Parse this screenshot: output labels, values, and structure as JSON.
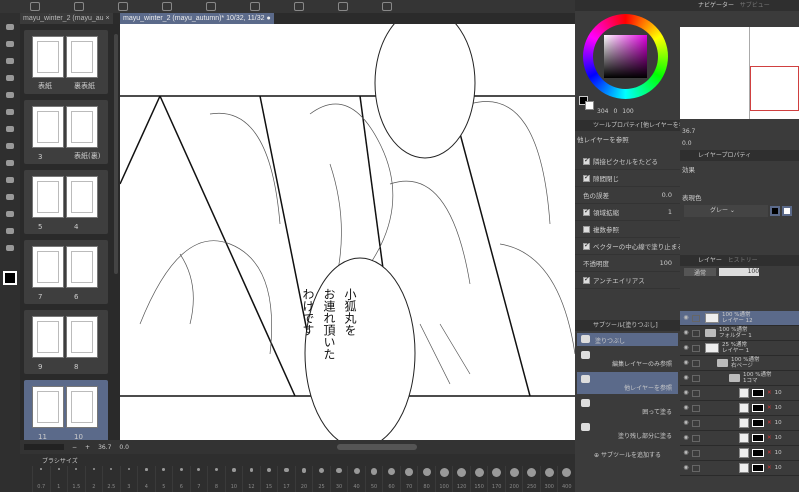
{
  "tabs": [
    {
      "label": "mayu_winter_2 (mayu_au"
    },
    {
      "label": "mayu_winter_2 (mayu_autumn)* 10/32, 11/32"
    }
  ],
  "pages": [
    {
      "left": "表紙",
      "right": "裏表紙"
    },
    {
      "left": "3",
      "right": "表紙(裏)"
    },
    {
      "left": "5",
      "right": "4"
    },
    {
      "left": "7",
      "right": "6"
    },
    {
      "left": "9",
      "right": "8"
    },
    {
      "left": "11",
      "right": "10",
      "selected": true
    }
  ],
  "canvas": {
    "bubble_text": [
      "小狐丸を",
      "お連れ頂いた",
      "わけです"
    ]
  },
  "status": {
    "zoom": "36.7",
    "angle": "0.0"
  },
  "brush_panel": {
    "title": "ブラシサイズ",
    "sizes": [
      "0.7",
      "1",
      "1.5",
      "2",
      "2.5",
      "3",
      "4",
      "5",
      "6",
      "7",
      "8",
      "10",
      "12",
      "15",
      "17",
      "20",
      "25",
      "30",
      "40",
      "50",
      "60",
      "70",
      "80",
      "100",
      "120",
      "150",
      "170",
      "200",
      "250",
      "300",
      "400"
    ]
  },
  "color": {
    "main": "#000000",
    "sub": "#ffffff",
    "h": "304",
    "s": "0",
    "v": "100",
    "hue_color": "#e000e0"
  },
  "navigator": {
    "tab": "ナビゲーター",
    "tab2": "サブビュー",
    "zoom": "36.7",
    "angle": "0.0"
  },
  "tool_property": {
    "title": "ツールプロパティ[他レイヤーを参",
    "subtool": "他レイヤーを参照",
    "rows": [
      {
        "label": "隣接ピクセルをたどる",
        "checked": true
      },
      {
        "label": "隙間閉じ",
        "checked": true
      },
      {
        "label": "色の誤差",
        "value": "0.0"
      },
      {
        "label": "領域拡縮",
        "checked": true,
        "value": "1"
      },
      {
        "label": "複数参照",
        "checked": false
      },
      {
        "label": "ベクターの中心線で塗り止まる",
        "checked": true
      },
      {
        "label": "不透明度",
        "value": "100"
      },
      {
        "label": "アンチエイリアス",
        "checked": true
      }
    ]
  },
  "subtool": {
    "title": "サブツール[塗りつぶし]",
    "group": "塗りつぶし",
    "items": [
      {
        "label": "編集レイヤーのみ参照"
      },
      {
        "label": "他レイヤーを参照",
        "selected": true
      },
      {
        "label": "囲って塗る"
      },
      {
        "label": "塗り残し部分に塗る"
      }
    ],
    "add": "サブツールを追加する"
  },
  "layer_property": {
    "title": "レイヤープロパティ",
    "effect": "効果",
    "color_label": "表現色",
    "color_mode": "グレー"
  },
  "layers_panel": {
    "tab": "レイヤー",
    "tab2": "ヒストリー",
    "blend": "通常",
    "opacity": "100",
    "layers": [
      {
        "mode": "100 %通常",
        "name": "レイヤー 12",
        "selected": true,
        "type": "raster"
      },
      {
        "mode": "100 %通常",
        "name": "フォルダー 1",
        "type": "folder"
      },
      {
        "mode": "25 %通常",
        "name": "レイヤー 1",
        "type": "raster"
      },
      {
        "mode": "100 %通常",
        "name": "右ページ",
        "type": "folder"
      },
      {
        "mode": "100 %通常",
        "name": "1コマ",
        "type": "folder"
      },
      {
        "mode": "10",
        "name": "",
        "type": "frame"
      },
      {
        "mode": "10",
        "name": "",
        "type": "frame"
      },
      {
        "mode": "10",
        "name": "",
        "type": "frame"
      },
      {
        "mode": "10",
        "name": "",
        "type": "frame"
      },
      {
        "mode": "10",
        "name": "",
        "type": "frame"
      },
      {
        "mode": "10",
        "name": "",
        "type": "frame"
      }
    ]
  }
}
